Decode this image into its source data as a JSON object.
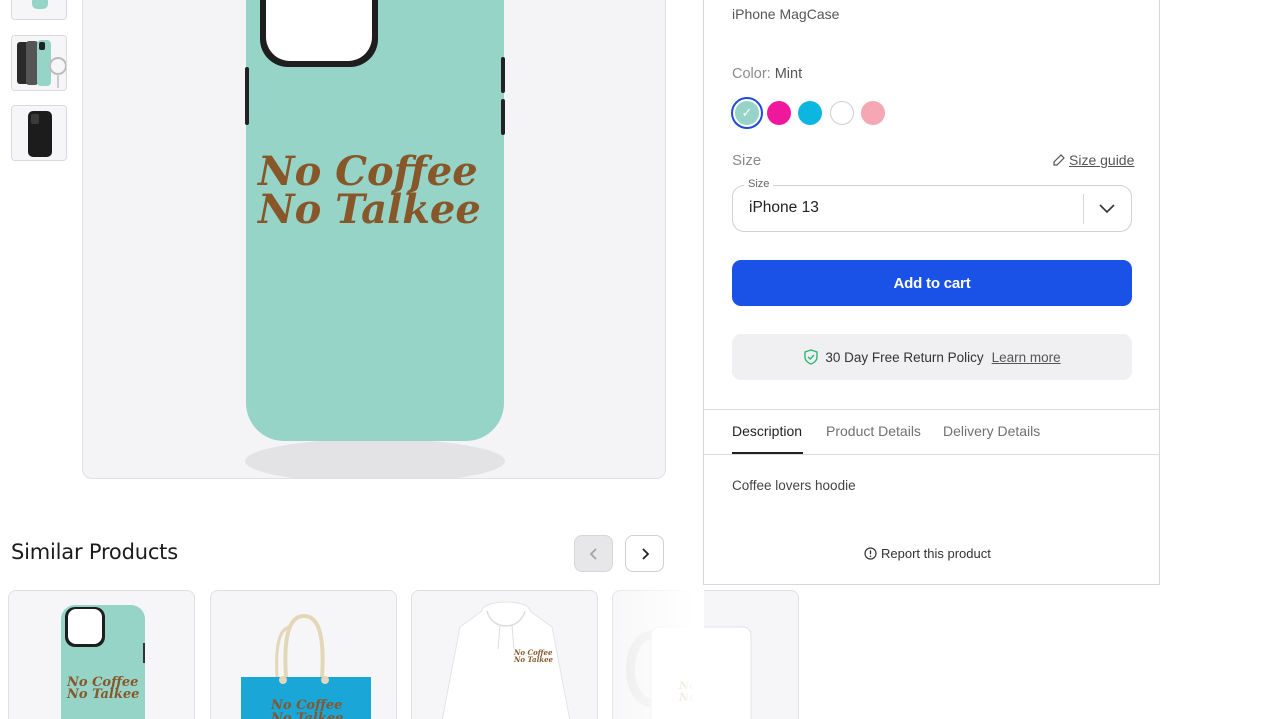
{
  "thumbnails": [
    {
      "name": "thumb-front-mint"
    },
    {
      "name": "thumb-multi-angle"
    },
    {
      "name": "thumb-black-back"
    }
  ],
  "main_image": {
    "print_line1": "No Coffee",
    "print_line2": "No Talkee",
    "case_color": "#96d4c8",
    "print_color": "#87572a"
  },
  "similar": {
    "title": "Similar Products",
    "prev_icon": "chevron-left-icon",
    "next_icon": "chevron-right-icon",
    "cards": [
      {
        "type": "phone-case",
        "line1": "No Coffee",
        "line2": "No Talkee"
      },
      {
        "type": "tote-bag",
        "line1": "No Coffee",
        "line2": "No Talkee"
      },
      {
        "type": "hoodie",
        "line1": "No Coffee",
        "line2": "No Talkee"
      },
      {
        "type": "mug",
        "line1": "No",
        "line2": "No"
      }
    ]
  },
  "product": {
    "subtitle": "iPhone MagCase",
    "color_label": "Color:",
    "color_value": "Mint",
    "swatches": [
      {
        "name": "Mint",
        "hex": "#96d4c8",
        "selected": true
      },
      {
        "name": "Pink",
        "hex": "#f0179c",
        "selected": false
      },
      {
        "name": "Cyan",
        "hex": "#0bb6e0",
        "selected": false
      },
      {
        "name": "White",
        "hex": "#ffffff",
        "selected": false
      },
      {
        "name": "Light Pink",
        "hex": "#f6a7b4",
        "selected": false
      }
    ],
    "size_label": "Size",
    "size_guide": "Size guide",
    "size_select": {
      "legend": "Size",
      "value": "iPhone 13"
    },
    "add_to_cart": "Add to cart",
    "return_policy": "30 Day Free Return Policy",
    "learn_more": "Learn more",
    "tabs": [
      {
        "label": "Description",
        "active": true
      },
      {
        "label": "Product Details",
        "active": false
      },
      {
        "label": "Delivery Details",
        "active": false
      }
    ],
    "description": "Coffee lovers hoodie",
    "report": "Report this product"
  },
  "colors": {
    "accent": "#1a52e8",
    "shield_green": "#2bb673"
  }
}
